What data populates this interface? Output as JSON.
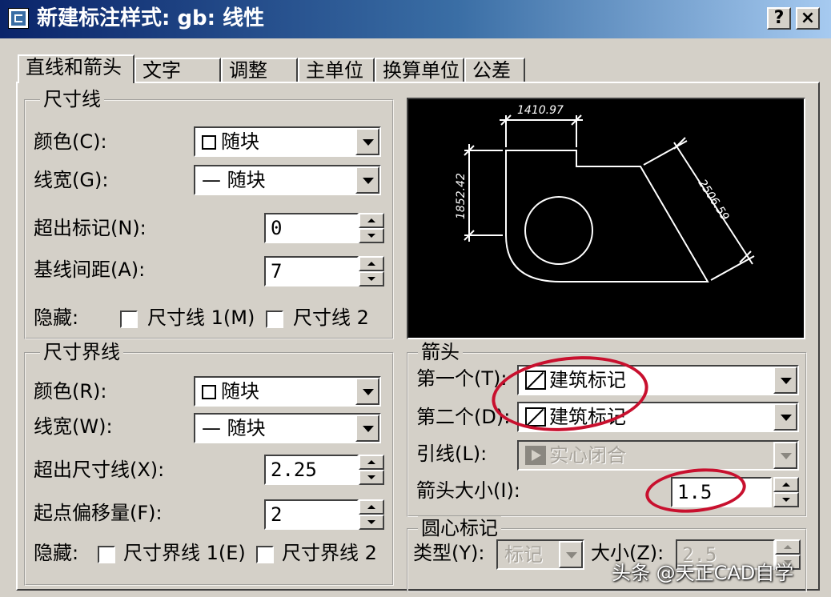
{
  "window": {
    "title": "新建标注样式: gb: 线性",
    "help_label": "?",
    "close_label": "×"
  },
  "tabs": [
    {
      "label": "直线和箭头",
      "active": true
    },
    {
      "label": "文字"
    },
    {
      "label": "调整"
    },
    {
      "label": "主单位"
    },
    {
      "label": "换算单位"
    },
    {
      "label": "公差"
    }
  ],
  "dim_line": {
    "group_label": "尺寸线",
    "color_label": "颜色(C):",
    "color_value": "随块",
    "lineweight_label": "线宽(G):",
    "lineweight_value": "— 随块",
    "extend_label": "超出标记(N):",
    "extend_value": "0",
    "baseline_label": "基线间距(A):",
    "baseline_value": "7",
    "suppress_label": "隐藏:",
    "suppress_1": "尺寸线 1(M)",
    "suppress_2": "尺寸线 2"
  },
  "ext_line": {
    "group_label": "尺寸界线",
    "color_label": "颜色(R):",
    "color_value": "随块",
    "lineweight_label": "线宽(W):",
    "lineweight_value": "— 随块",
    "extend_label": "超出尺寸线(X):",
    "extend_value": "2.25",
    "offset_label": "起点偏移量(F):",
    "offset_value": "2",
    "suppress_label": "隐藏:",
    "suppress_1": "尺寸界线 1(E)",
    "suppress_2": "尺寸界线 2"
  },
  "preview": {
    "dim_top": "1410.97",
    "dim_left": "1852.42",
    "dim_diag": "2506.59"
  },
  "arrowheads": {
    "group_label": "箭头",
    "first_label": "第一个(T):",
    "first_value": "建筑标记",
    "second_label": "第二个(D):",
    "second_value": "建筑标记",
    "leader_label": "引线(L):",
    "leader_value": "实心闭合",
    "size_label": "箭头大小(I):",
    "size_value": "1.5"
  },
  "center_marks": {
    "group_label": "圆心标记",
    "type_label": "类型(Y):",
    "type_value": "标记",
    "size_label": "大小(Z):",
    "size_value": "2.5"
  },
  "watermark": "头条 @天正CAD自学",
  "colors": {
    "title_bar": "#0a246a",
    "face": "#d4d0c8",
    "annotation_ring": "#c8102e"
  }
}
